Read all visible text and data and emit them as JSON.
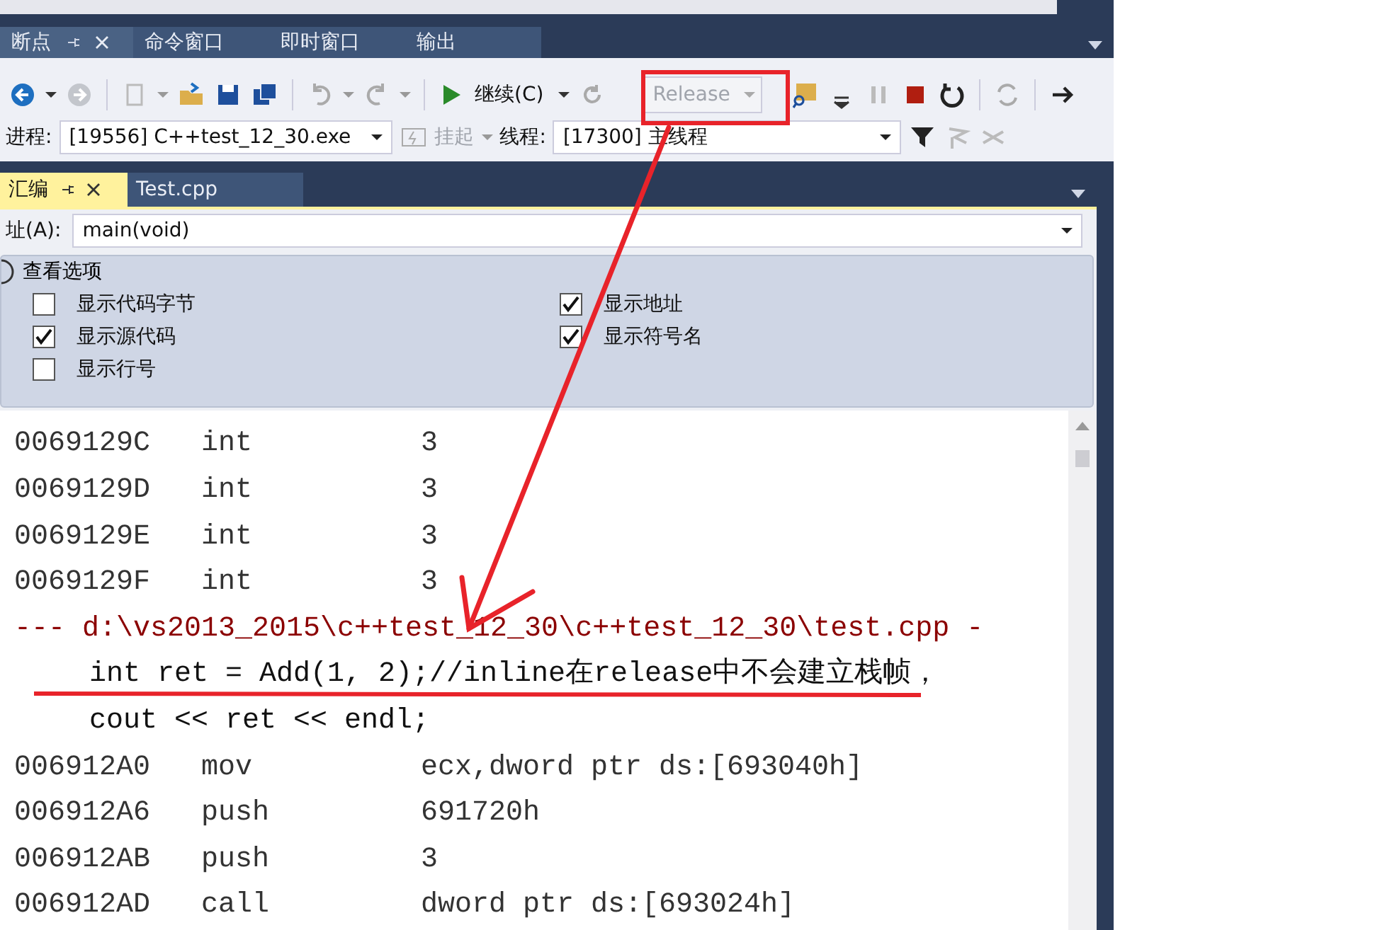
{
  "tool_tabs": [
    {
      "label": "断点",
      "selected": true
    },
    {
      "label": "命令窗口",
      "selected": false
    },
    {
      "label": "即时窗口",
      "selected": false
    },
    {
      "label": "输出",
      "selected": false
    }
  ],
  "toolbar": {
    "continue_button": "继续(C)",
    "configuration": {
      "value": "Release",
      "disabled": true
    }
  },
  "debug_location": {
    "process_label": "进程:",
    "process": "[19556] C++test_12_30.exe",
    "suspend": "挂起",
    "thread_label": "线程:",
    "thread": "[17300] 主线程"
  },
  "document_tabs": [
    {
      "label": "汇编",
      "selected": true
    },
    {
      "label": "Test.cpp",
      "selected": false
    }
  ],
  "address": {
    "label": "址(A):",
    "value": "main(void)"
  },
  "view_options": {
    "title": "查看选项",
    "options": [
      {
        "label": "显示代码字节",
        "checked": false
      },
      {
        "label": "显示地址",
        "checked": true
      },
      {
        "label": "显示源代码",
        "checked": true
      },
      {
        "label": "显示符号名",
        "checked": true
      },
      {
        "label": "显示行号",
        "checked": false
      }
    ]
  },
  "code_lines": [
    {
      "kind": "instruction",
      "address": "0069129C",
      "mnemonic": "int",
      "operand": "3"
    },
    {
      "kind": "instruction",
      "address": "0069129D",
      "mnemonic": "int",
      "operand": "3"
    },
    {
      "kind": "instruction",
      "address": "0069129E",
      "mnemonic": "int",
      "operand": "3"
    },
    {
      "kind": "instruction",
      "address": "0069129F",
      "mnemonic": "int",
      "operand": "3"
    },
    {
      "kind": "file",
      "text": "--- d:\\vs2013_2015\\c++test_12_30\\c++test_12_30\\test.cpp -"
    },
    {
      "kind": "source",
      "text": "int ret = Add(1, 2);//inline在release中不会建立栈帧，"
    },
    {
      "kind": "source",
      "text": "cout << ret << endl;"
    },
    {
      "kind": "instruction",
      "address": "006912A0",
      "mnemonic": "mov",
      "operand": "ecx,dword ptr ds:[693040h]"
    },
    {
      "kind": "instruction",
      "address": "006912A6",
      "mnemonic": "push",
      "operand": "691720h"
    },
    {
      "kind": "instruction",
      "address": "006912AB",
      "mnemonic": "push",
      "operand": "3"
    },
    {
      "kind": "instruction",
      "address": "006912AD",
      "mnemonic": "call",
      "operand": "dword ptr ds:[693024h]"
    }
  ]
}
